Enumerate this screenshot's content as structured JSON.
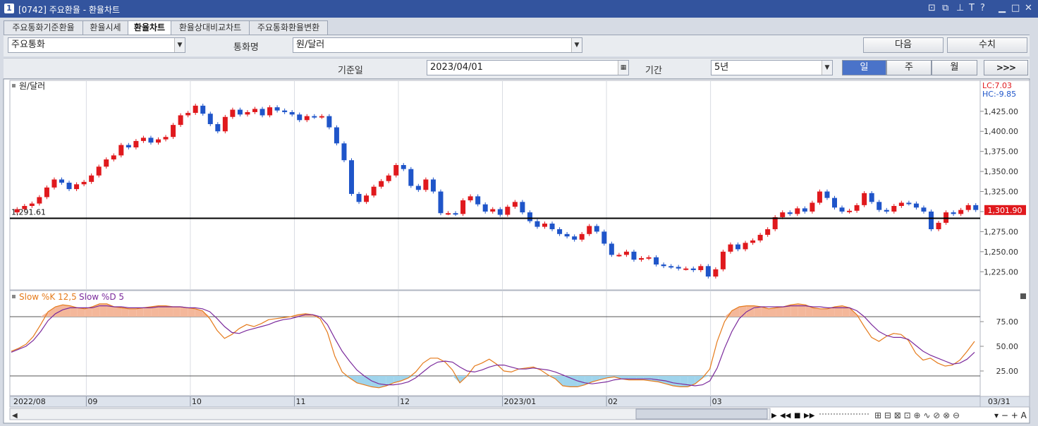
{
  "window": {
    "badge": "1",
    "title": "[0742] 주요환율 - 환율차트"
  },
  "tabs": [
    "주요통화기준환율",
    "환율시세",
    "환율차트",
    "환율상대비교차트",
    "주요통화환율변환"
  ],
  "controls": {
    "currency_group": "주요통화",
    "currency_label": "통화명",
    "currency": "원/달러",
    "next_button": "다음",
    "values_button": "수치",
    "base_date_label": "기준일",
    "base_date": "2023/04/01",
    "period_label": "기간",
    "period": "5년",
    "interval_day": "일",
    "interval_week": "주",
    "interval_month": "월",
    "expand_button": ">>>"
  },
  "chart_data": [
    {
      "type": "candlestick",
      "title": "원/달러",
      "ylim": [
        1205,
        1460
      ],
      "yticks": [
        "1,425.00",
        "1,400.00",
        "1,375.00",
        "1,350.00",
        "1,325.00",
        "1,300.00",
        "1,275.00",
        "1,250.00",
        "1,225.00"
      ],
      "ytick_values": [
        1425,
        1400,
        1375,
        1350,
        1325,
        1300,
        1275,
        1250,
        1225
      ],
      "reference_line": {
        "value": 1291.61,
        "label": "1,291.61"
      },
      "last_price": {
        "value": 1301.9,
        "label": "1,301.90"
      },
      "lc_label": "LC:7.03",
      "hc_label": "HC:-9.85",
      "up_color": "#e0191d",
      "down_color": "#1f55c9",
      "close": [
        1303,
        1307,
        1310,
        1318,
        1330,
        1340,
        1336,
        1328,
        1334,
        1337,
        1345,
        1356,
        1365,
        1370,
        1383,
        1380,
        1388,
        1392,
        1386,
        1390,
        1393,
        1408,
        1420,
        1423,
        1432,
        1422,
        1409,
        1400,
        1418,
        1427,
        1421,
        1424,
        1428,
        1420,
        1430,
        1426,
        1424,
        1421,
        1414,
        1419,
        1418,
        1419,
        1405,
        1385,
        1364,
        1322,
        1312,
        1320,
        1331,
        1338,
        1345,
        1358,
        1353,
        1332,
        1327,
        1340,
        1325,
        1298,
        1298,
        1297,
        1314,
        1319,
        1309,
        1300,
        1303,
        1296,
        1306,
        1312,
        1299,
        1288,
        1281,
        1285,
        1278,
        1272,
        1269,
        1265,
        1272,
        1282,
        1275,
        1260,
        1246,
        1246,
        1250,
        1240,
        1242,
        1243,
        1234,
        1232,
        1231,
        1229,
        1229,
        1227,
        1232,
        1219,
        1228,
        1250,
        1259,
        1253,
        1261,
        1264,
        1271,
        1278,
        1293,
        1299,
        1297,
        1304,
        1300,
        1311,
        1325,
        1317,
        1305,
        1300,
        1301,
        1308,
        1323,
        1312,
        1302,
        1300,
        1307,
        1311,
        1310,
        1305,
        1300,
        1278,
        1286,
        1299,
        1297,
        1302,
        1308,
        1302
      ]
    },
    {
      "type": "line",
      "title_k": "Slow %K 12,5",
      "title_d": "Slow %D 5",
      "ylim": [
        0,
        105
      ],
      "yticks": [
        "75.00",
        "50.00",
        "25.00"
      ],
      "ytick_values": [
        75,
        50,
        25
      ],
      "overbought": 80,
      "oversold": 20,
      "series": [
        {
          "name": "Slow %K 12,5",
          "color": "#e57a1a",
          "values": [
            45,
            48,
            52,
            60,
            72,
            85,
            90,
            92,
            91,
            89,
            88,
            90,
            93,
            93,
            90,
            89,
            88,
            88,
            89,
            90,
            91,
            91,
            90,
            90,
            89,
            88,
            86,
            78,
            66,
            58,
            62,
            68,
            72,
            70,
            73,
            77,
            78,
            79,
            80,
            82,
            83,
            82,
            78,
            64,
            40,
            24,
            18,
            13,
            11,
            9,
            8,
            10,
            13,
            15,
            18,
            24,
            33,
            38,
            38,
            34,
            26,
            13,
            20,
            30,
            33,
            37,
            32,
            25,
            24,
            27,
            28,
            29,
            26,
            21,
            17,
            10,
            9,
            9,
            11,
            14,
            16,
            18,
            19,
            17,
            16,
            16,
            16,
            15,
            14,
            12,
            10,
            9,
            9,
            12,
            18,
            27,
            55,
            75,
            86,
            90,
            91,
            91,
            90,
            88,
            89,
            90,
            92,
            93,
            92,
            89,
            88,
            88,
            90,
            91,
            89,
            82,
            70,
            59,
            55,
            60,
            63,
            62,
            56,
            43,
            36,
            38,
            33,
            30,
            31,
            36,
            45,
            55
          ]
        },
        {
          "name": "Slow %D 5",
          "color": "#7b2a9c",
          "values": [
            44,
            47,
            50,
            56,
            65,
            76,
            83,
            87,
            89,
            89,
            89,
            89,
            91,
            91,
            90,
            90,
            89,
            89,
            89,
            89,
            90,
            90,
            90,
            90,
            89,
            89,
            88,
            85,
            78,
            70,
            64,
            63,
            66,
            68,
            70,
            72,
            75,
            77,
            78,
            80,
            82,
            82,
            80,
            72,
            58,
            45,
            35,
            26,
            20,
            15,
            12,
            11,
            11,
            12,
            14,
            18,
            24,
            30,
            34,
            35,
            34,
            29,
            25,
            24,
            26,
            29,
            31,
            31,
            29,
            27,
            27,
            28,
            27,
            26,
            24,
            21,
            18,
            15,
            13,
            12,
            13,
            14,
            16,
            17,
            17,
            17,
            17,
            17,
            16,
            15,
            13,
            12,
            11,
            10,
            11,
            15,
            28,
            48,
            65,
            78,
            85,
            89,
            90,
            90,
            90,
            90,
            91,
            91,
            91,
            90,
            90,
            89,
            89,
            89,
            89,
            86,
            80,
            72,
            65,
            61,
            59,
            59,
            57,
            51,
            45,
            41,
            38,
            35,
            32,
            33,
            37,
            44
          ]
        }
      ]
    }
  ],
  "xaxis": {
    "labels": [
      "2022/08",
      "09",
      "10",
      "11",
      "12",
      "2023/01",
      "02",
      "03"
    ],
    "label_index": [
      0,
      10,
      24,
      38,
      52,
      66,
      80,
      94
    ],
    "end_label": "03/31"
  },
  "statusbar": {
    "play": "▶",
    "rewind": "◀◀",
    "stop": "■",
    "forward": "▶▶",
    "icons": "⊞ ⊟ ⊠ ⊡ ⊕ ∿ ⊘ ⊗ ⊖",
    "zoom": "▾ − + A"
  }
}
